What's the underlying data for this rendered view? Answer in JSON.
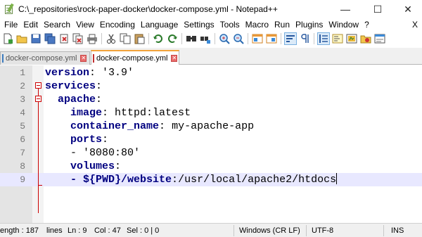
{
  "window": {
    "title": "C:\\_repositories\\rock-paper-docker\\docker-compose.yml - Notepad++",
    "minimize": "—",
    "maximize": "☐",
    "close": "✕"
  },
  "menu": {
    "items": [
      "File",
      "Edit",
      "Search",
      "View",
      "Encoding",
      "Language",
      "Settings",
      "Tools",
      "Macro",
      "Run",
      "Plugins",
      "Window",
      "?"
    ],
    "close_doc": "X"
  },
  "toolbar": {
    "icons": [
      "new-file-icon",
      "open-file-icon",
      "save-icon",
      "save-all-icon",
      "close-icon",
      "close-all-icon",
      "print-icon",
      "cut-icon",
      "copy-icon",
      "paste-icon",
      "undo-icon",
      "redo-icon",
      "find-icon",
      "replace-icon",
      "zoom-in-icon",
      "zoom-out-icon",
      "sync-v-icon",
      "sync-h-icon",
      "word-wrap-icon",
      "show-all-chars-icon",
      "indent-guide-icon",
      "doc-map-icon",
      "function-list-icon",
      "folder-workspace-icon",
      "monitoring-icon"
    ]
  },
  "tabs": [
    {
      "label": "docker-compose.yml",
      "active": false
    },
    {
      "label": "docker-compose.yml",
      "active": true
    }
  ],
  "editor": {
    "lines": [
      {
        "num": "1",
        "parts": [
          [
            "key",
            "version"
          ],
          [
            "punc",
            ": "
          ],
          [
            "str",
            "'3.9'"
          ]
        ]
      },
      {
        "num": "2",
        "parts": [
          [
            "key",
            "services"
          ],
          [
            "punc",
            ":"
          ]
        ]
      },
      {
        "num": "3",
        "parts": [
          [
            "val",
            "  "
          ],
          [
            "key",
            "apache"
          ],
          [
            "punc",
            ":"
          ]
        ]
      },
      {
        "num": "4",
        "parts": [
          [
            "val",
            "    "
          ],
          [
            "key",
            "image"
          ],
          [
            "punc",
            ": "
          ],
          [
            "val",
            "httpd:latest"
          ]
        ]
      },
      {
        "num": "5",
        "parts": [
          [
            "val",
            "    "
          ],
          [
            "key",
            "container_name"
          ],
          [
            "punc",
            ": "
          ],
          [
            "val",
            "my-apache-app"
          ]
        ]
      },
      {
        "num": "6",
        "parts": [
          [
            "val",
            "    "
          ],
          [
            "key",
            "ports"
          ],
          [
            "punc",
            ":"
          ]
        ]
      },
      {
        "num": "7",
        "parts": [
          [
            "val",
            "    "
          ],
          [
            "punc",
            "- "
          ],
          [
            "str",
            "'8080:80'"
          ]
        ]
      },
      {
        "num": "8",
        "parts": [
          [
            "val",
            "    "
          ],
          [
            "key",
            "volumes"
          ],
          [
            "punc",
            ":"
          ]
        ]
      },
      {
        "num": "9",
        "parts": [
          [
            "val",
            "    "
          ],
          [
            "key",
            "- ${PWD}/website"
          ],
          [
            "punc",
            ":"
          ],
          [
            "val",
            "/usr/local/apache2/htdocs"
          ]
        ]
      }
    ],
    "current_line": 9
  },
  "status": {
    "length": "ength : 187",
    "lines": "lines",
    "ln": "Ln : 9",
    "col": "Col : 47",
    "sel": "Sel : 0 | 0",
    "eol": "Windows (CR LF)",
    "encoding": "UTF-8",
    "mode": "INS"
  }
}
